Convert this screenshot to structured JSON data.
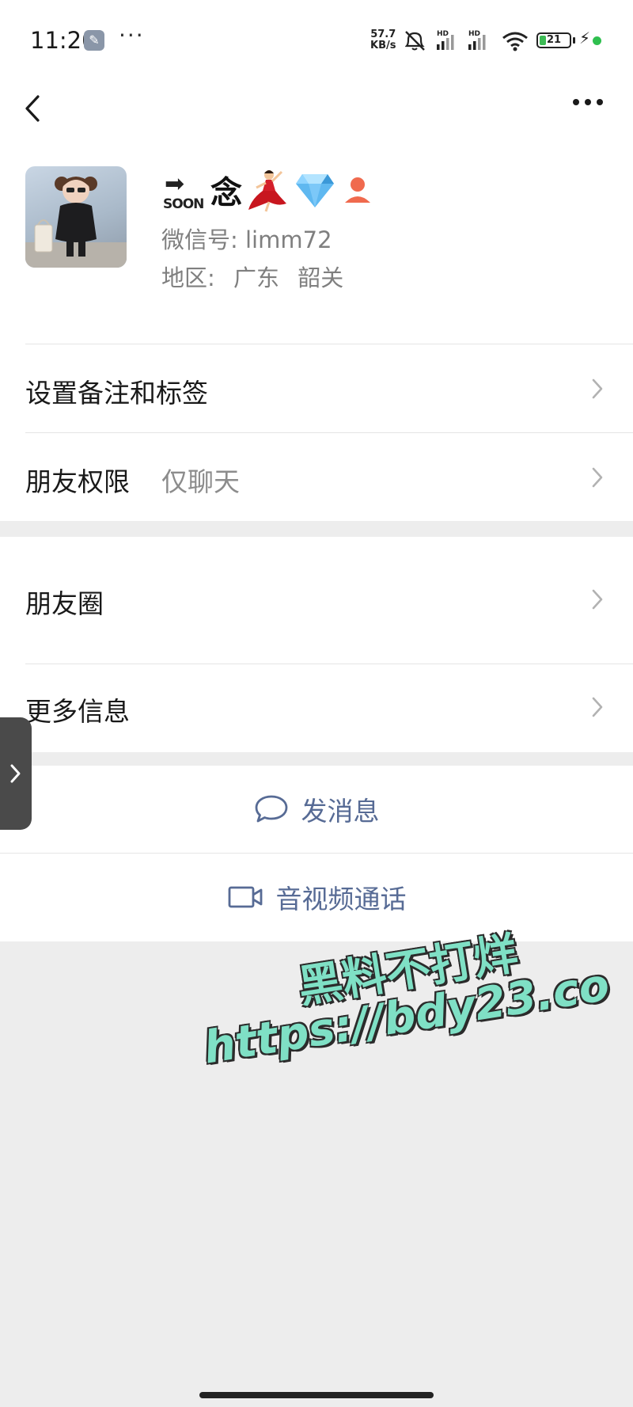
{
  "status_bar": {
    "time": "11:20",
    "more_dots": "···",
    "net_speed_value": "57.7",
    "net_speed_unit": "KB/s",
    "hd1": "HD",
    "hd2": "HD",
    "battery_level": "21",
    "battery_fraction": 0.21,
    "icons": [
      "wrench-icon",
      "mute-icon",
      "signal-icon",
      "signal-icon",
      "wifi-icon",
      "battery-icon",
      "charging-icon",
      "dot-icon"
    ]
  },
  "nav": {
    "back_icon": "chevron-left-icon",
    "more_icon": "more-horizontal-icon"
  },
  "profile": {
    "badge_text": "SOON",
    "badge_arrow": "➡",
    "name": "念",
    "name_icons": [
      "dancer-icon",
      "gem-icon",
      "person-icon"
    ],
    "wechat_id_label": "微信号:",
    "wechat_id_value": "limm72",
    "region_label": "地区:",
    "region_province": "广东",
    "region_city": "韶关"
  },
  "cells": {
    "remark_tags": "设置备注和标签",
    "friend_permission_label": "朋友权限",
    "friend_permission_value": "仅聊天",
    "moments": "朋友圈",
    "more_info": "更多信息"
  },
  "actions": {
    "send_message": "发消息",
    "av_call": "音视频通话"
  },
  "watermark": {
    "line1": "黑料不打烊",
    "line2": "https://bdy23.co"
  },
  "colors": {
    "link_blue": "#576b95",
    "bg_gray": "#ededed",
    "watermark_mint": "#7fe0c5"
  }
}
